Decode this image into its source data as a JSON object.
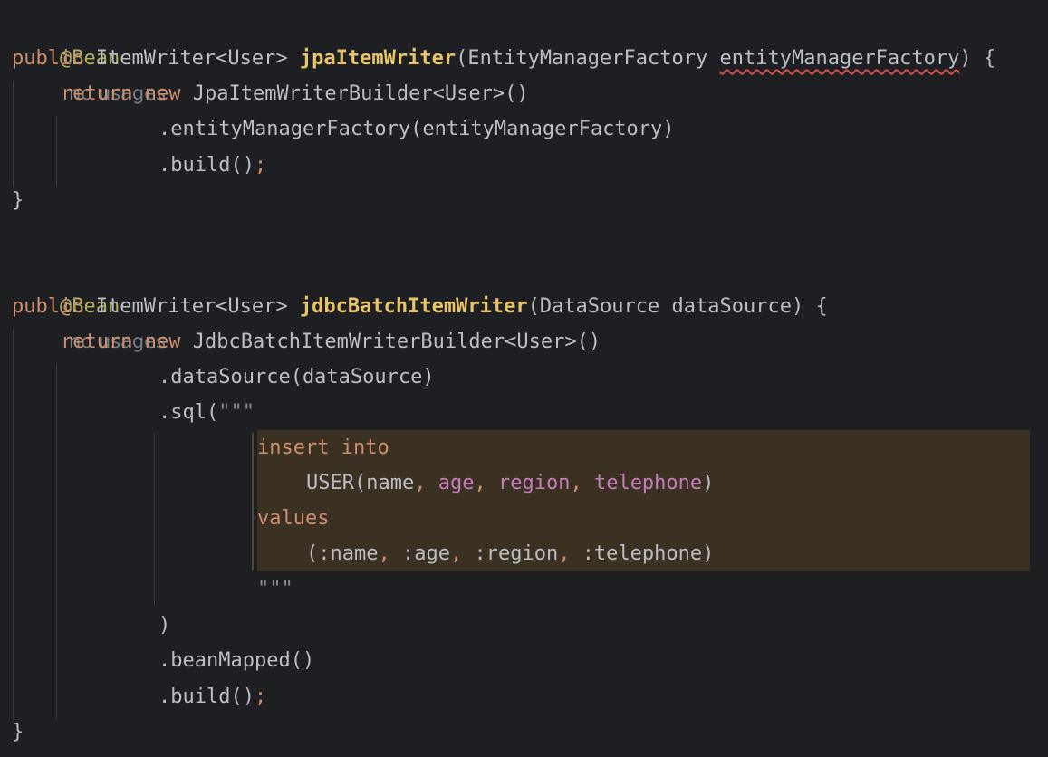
{
  "code": {
    "annotation": "@Bean",
    "usage_hint": "no usages",
    "kw_public": "public",
    "kw_return": "return",
    "kw_new": "new",
    "method1": {
      "return_type": "ItemWriter<User>",
      "name": "jpaItemWriter",
      "param_type": "EntityManagerFactory",
      "param_name": "entityManagerFactory",
      "open": "(",
      "close": ") {",
      "builder": "JpaItemWriterBuilder<User>()",
      "call1": ".entityManagerFactory(entityManagerFactory)",
      "call2": ".build()",
      "semi": ";",
      "end": "}"
    },
    "method2": {
      "return_type": "ItemWriter<User>",
      "name": "jdbcBatchItemWriter",
      "params": "(DataSource dataSource) {",
      "builder": "JdbcBatchItemWriterBuilder<User>()",
      "call1": ".dataSource(dataSource)",
      "sql_open": ".sql(",
      "triple_quote": "\"\"\"",
      "sql_kw1": "insert into",
      "sql_table": "USER(name",
      "sql_col_age": "age",
      "sql_col_region": "region",
      "sql_col_telephone": "telephone",
      "sql_close_paren": ")",
      "sql_kw2": "values",
      "sql_values_start": "(:name",
      "sql_values_age": ":age",
      "sql_values_region": ":region",
      "sql_values_tel": ":telephone)",
      "comma": ",",
      "close_paren": ")",
      "call_bean": ".beanMapped()",
      "call_build": ".build()",
      "semi": ";",
      "end": "}"
    }
  }
}
